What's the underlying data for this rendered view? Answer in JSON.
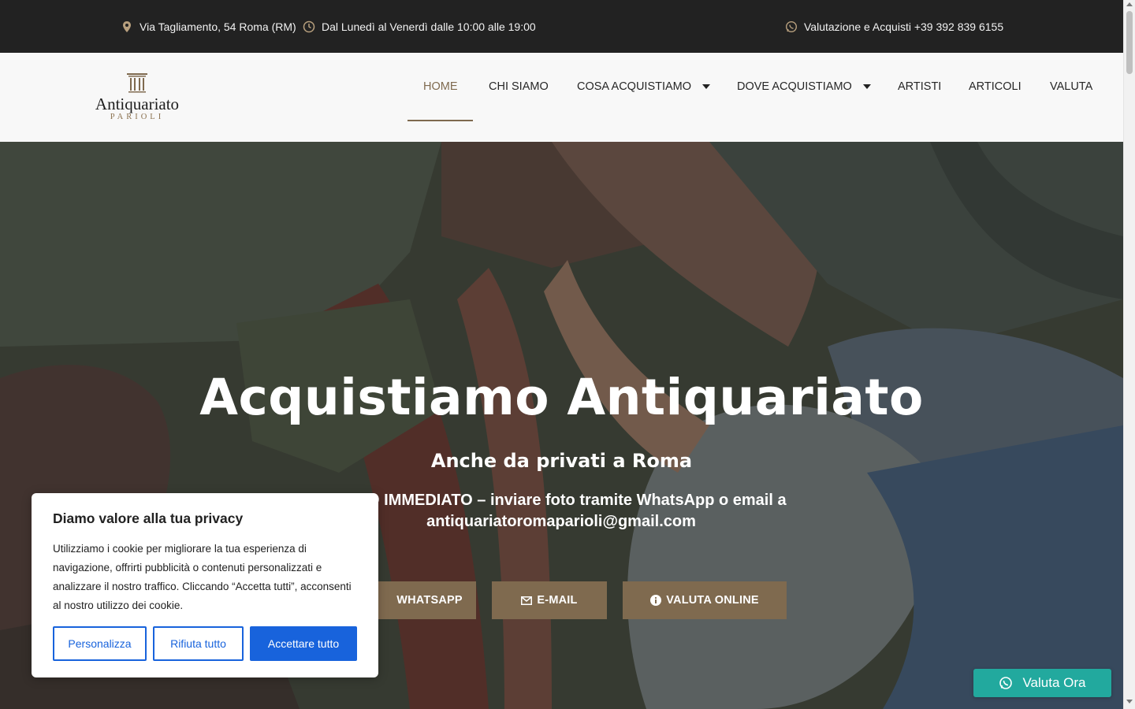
{
  "topbar": {
    "address": "Via Tagliamento, 54 Roma (RM)",
    "hours": "Dal Lunedì al Venerdì dalle 10:00 alle 19:00",
    "contact": "Valutazione e Acquisti +39 392 839 6155",
    "icons": [
      "map-pin-icon",
      "clock-icon",
      "whatsapp-icon"
    ]
  },
  "logo": {
    "name": "Antiquariato",
    "sub": "PARIOLI"
  },
  "nav": {
    "items": [
      {
        "label": "HOME",
        "active": true
      },
      {
        "label": "CHI SIAMO"
      },
      {
        "label": "COSA ACQUISTIAMO",
        "dropdown": true
      },
      {
        "label": "DOVE ACQUISTIAMO",
        "dropdown": true
      },
      {
        "label": "ARTISTI"
      },
      {
        "label": "ARTICOLI"
      },
      {
        "label": "VALUTA"
      }
    ]
  },
  "hero": {
    "title": "Acquistiamo Antiquariato",
    "subtitle": "Anche da privati a Roma",
    "text_line1": "ENTO IMMEDIATO – inviare foto tramite WhatsApp o email a",
    "text_line2": "antiquariatoromaparioli@gmail.com",
    "buttons": {
      "whatsapp": "WHATSAPP",
      "email": "E-MAIL",
      "valuta": "VALUTA ONLINE"
    }
  },
  "cookie": {
    "title": "Diamo valore alla tua privacy",
    "text": "Utilizziamo i cookie per migliorare la tua esperienza di navigazione, offrirti pubblicità o contenuti personalizzati e analizzare il nostro traffico. Cliccando “Accetta tutti”, acconsenti al nostro utilizzo dei cookie.",
    "customize": "Personalizza",
    "reject": "Rifiuta tutto",
    "accept": "Accettare tutto"
  },
  "float_button": {
    "label": "Valuta Ora"
  },
  "colors": {
    "accent": "#7f6a4f",
    "topbar_bg": "#222222",
    "cookie_blue": "#1863dc",
    "float_green": "#22a99e"
  }
}
